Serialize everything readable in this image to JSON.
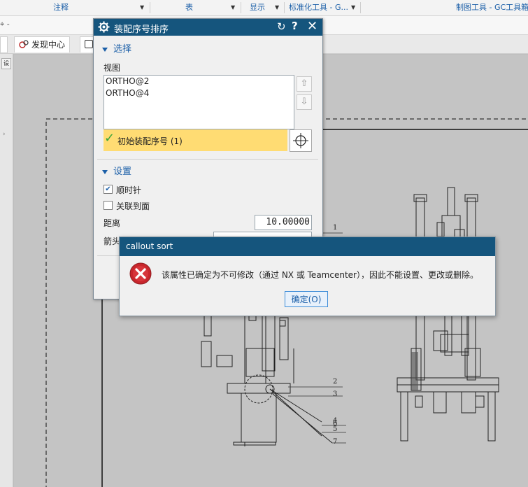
{
  "ribbon": {
    "items": [
      "注释",
      "表",
      "显示",
      "标准化工具 - G...",
      "制图工具 - GC工具箱"
    ]
  },
  "toolbar2": {
    "left_glyph": "⌖ -"
  },
  "tabs": {
    "discovery": "发现中心"
  },
  "sort_dialog": {
    "title": "装配序号排序",
    "select_section": "选择",
    "view_label": "视图",
    "views": [
      "ORTHO@2",
      "ORTHO@4"
    ],
    "initial_callout": "初始装配序号 (1)",
    "settings_section": "设置",
    "clockwise_label": "顺时针",
    "clockwise_checked": true,
    "associate_label": "关联到面",
    "associate_checked": false,
    "distance_label": "距离",
    "distance_value": "10.00000",
    "arrow_label": "箭头"
  },
  "message_box": {
    "title": "callout sort",
    "text": "该属性已确定为不可修改（通过 NX 或 Teamcenter），因此不能设置、更改或删除。",
    "ok_label": "确定(O)"
  },
  "drawing": {
    "callout_numbers": [
      "1",
      "2",
      "3",
      "4",
      "5",
      "6",
      "7"
    ]
  },
  "colors": {
    "title_bar": "#15557d",
    "highlight": "#ffdc73",
    "link_blue": "#1b5fa8",
    "error_red": "#c8262c"
  }
}
